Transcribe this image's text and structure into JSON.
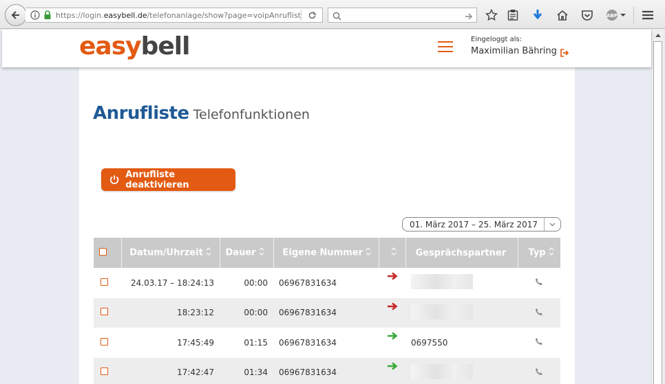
{
  "browser": {
    "url_prefix": "https://login.",
    "url_domain": "easybell.de",
    "url_path": "/telefonanlage/show?page=voipAnrufliste",
    "search_placeholder": ""
  },
  "header": {
    "logo_part1": "easy",
    "logo_part2": "bell",
    "login_caption": "Eingeloggt als:",
    "user_name": "Maximilian Bähring"
  },
  "page": {
    "title": "Anrufliste",
    "subtitle": "Telefonfunktionen",
    "deactivate_button": "Anrufliste deaktivieren",
    "date_range": "01. März 2017 – 25. März 2017"
  },
  "table": {
    "headers": {
      "datetime": "Datum/Uhrzeit",
      "duration": "Dauer",
      "own_number": "Eigene Nummer",
      "partner": "Gesprächspartner",
      "type": "Typ"
    },
    "rows": [
      {
        "datetime": "24.03.17 – 18:24:13",
        "duration": "00:00",
        "own_number": "06967831634",
        "direction": "outgoing",
        "partner": ""
      },
      {
        "datetime": "18:23:12",
        "duration": "00:00",
        "own_number": "06967831634",
        "direction": "outgoing",
        "partner": ""
      },
      {
        "datetime": "17:45:49",
        "duration": "01:15",
        "own_number": "06967831634",
        "direction": "incoming",
        "partner": "0697550"
      },
      {
        "datetime": "17:42:47",
        "duration": "01:34",
        "own_number": "06967831634",
        "direction": "incoming",
        "partner": ""
      }
    ]
  },
  "colors": {
    "brand_orange": "#e35a12",
    "title_blue": "#1f5a96",
    "outgoing_red": "#c62828",
    "incoming_green": "#3aa83a"
  }
}
